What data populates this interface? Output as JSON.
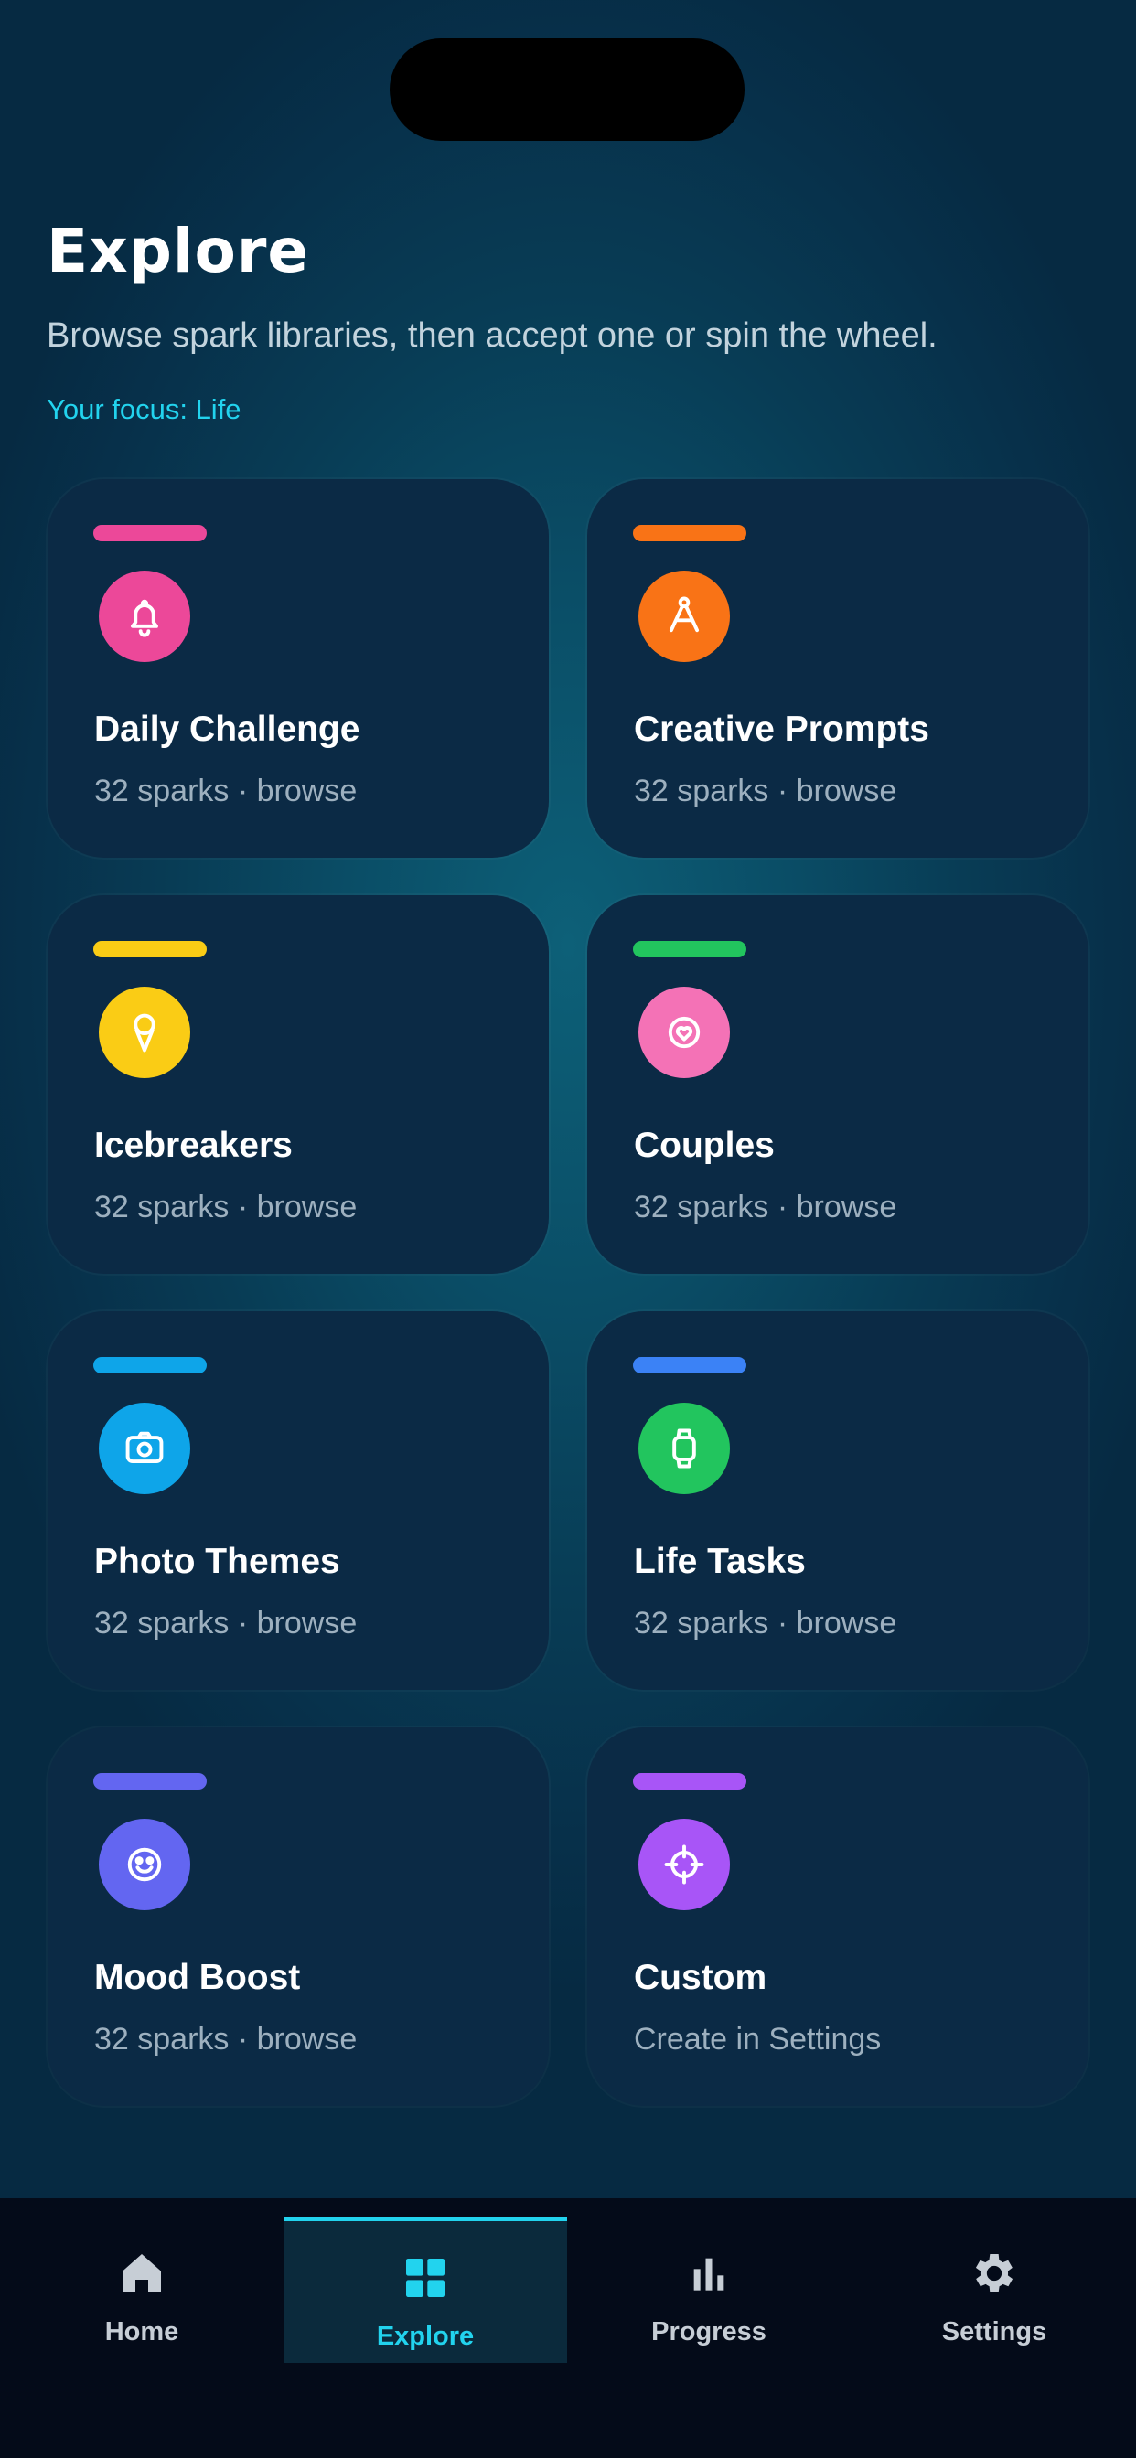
{
  "header": {
    "title": "Explore",
    "subtitle": "Browse spark libraries, then accept one or spin the wheel.",
    "focus": "Your focus: Life"
  },
  "cards": [
    {
      "name": "Daily Challenge",
      "meta": "32 sparks · browse",
      "icon": "bell-icon",
      "color": "#ec4899",
      "bar_color": "#ec4899"
    },
    {
      "name": "Creative Prompts",
      "meta": "32 sparks · browse",
      "icon": "compass-icon",
      "color": "#f97316",
      "bar_color": "#f97316"
    },
    {
      "name": "Icebreakers",
      "meta": "32 sparks · browse",
      "icon": "ice-cream-icon",
      "color": "#facc15",
      "bar_color": "#facc15"
    },
    {
      "name": "Couples",
      "meta": "32 sparks · browse",
      "icon": "heart-icon",
      "color": "#f472b6",
      "bar_color": "#22c55e"
    },
    {
      "name": "Photo Themes",
      "meta": "32 sparks · browse",
      "icon": "camera-icon",
      "color": "#0ea5e9",
      "bar_color": "#0ea5e9"
    },
    {
      "name": "Life Tasks",
      "meta": "32 sparks · browse",
      "icon": "watch-icon",
      "color": "#22c55e",
      "bar_color": "#3b82f6"
    },
    {
      "name": "Mood Boost",
      "meta": "32 sparks · browse",
      "icon": "smile-icon",
      "color": "#6366f1",
      "bar_color": "#6366f1"
    },
    {
      "name": "Custom",
      "meta": "Create in Settings",
      "icon": "crosshair-icon",
      "color": "#a855f7",
      "bar_color": "#a855f7"
    }
  ],
  "tabs": [
    {
      "label": "Home",
      "icon": "home-icon",
      "active": false
    },
    {
      "label": "Explore",
      "icon": "grid-icon",
      "active": true
    },
    {
      "label": "Progress",
      "icon": "bar-chart-icon",
      "active": false
    },
    {
      "label": "Settings",
      "icon": "gear-icon",
      "active": false
    }
  ],
  "colors": {
    "accent": "#22d3ee",
    "card_bg": "#0b2a45",
    "tab_bg": "#040b19"
  }
}
